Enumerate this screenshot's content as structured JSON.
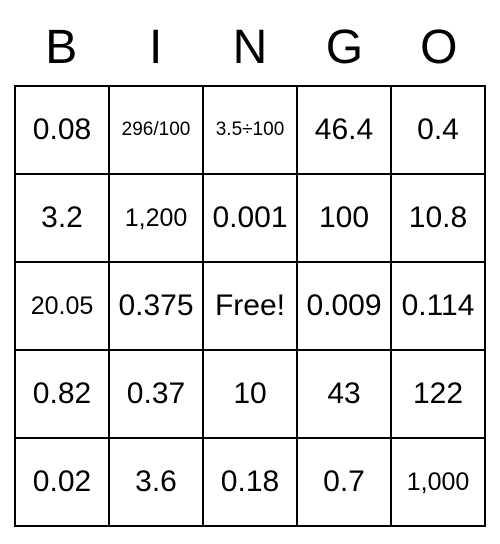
{
  "header": [
    "B",
    "I",
    "N",
    "G",
    "O"
  ],
  "cells": [
    [
      "0.08",
      "296/100",
      "3.5÷100",
      "46.4",
      "0.4"
    ],
    [
      "3.2",
      "1,200",
      "0.001",
      "100",
      "10.8"
    ],
    [
      "20.05",
      "0.375",
      "Free!",
      "0.009",
      "0.114"
    ],
    [
      "0.82",
      "0.37",
      "10",
      "43",
      "122"
    ],
    [
      "0.02",
      "3.6",
      "0.18",
      "0.7",
      "1,000"
    ]
  ],
  "sizes": [
    [
      "",
      "small",
      "small",
      "",
      ""
    ],
    [
      "",
      "med",
      "",
      "",
      ""
    ],
    [
      "med",
      "",
      "",
      "",
      ""
    ],
    [
      "",
      "",
      "",
      "",
      ""
    ],
    [
      "",
      "",
      "",
      "",
      "med"
    ]
  ]
}
